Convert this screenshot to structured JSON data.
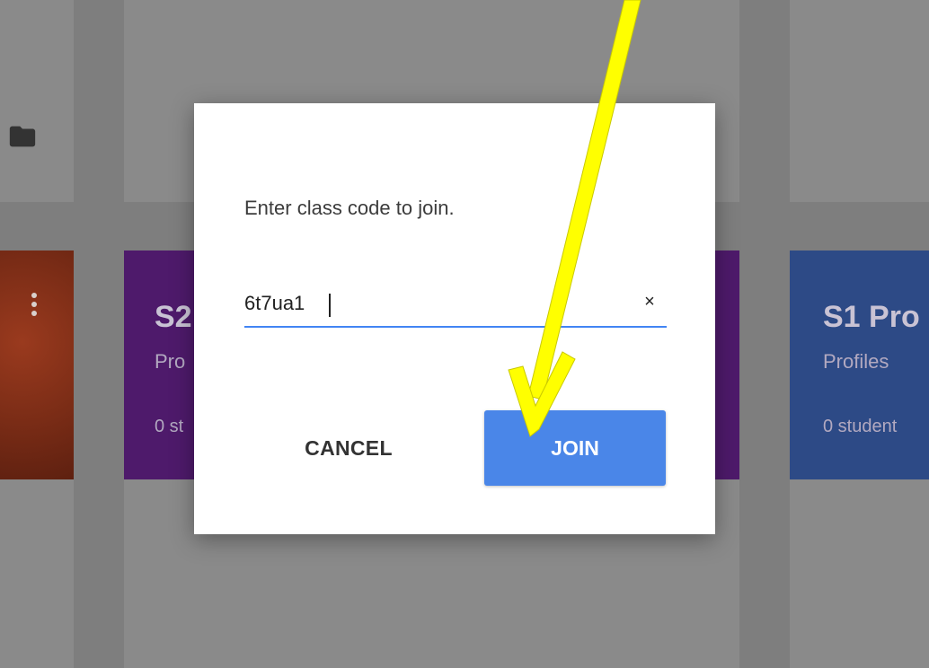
{
  "background": {
    "cards": [
      {
        "title": "",
        "subtitle": "",
        "count": ""
      },
      {
        "title": "S2",
        "subtitle": "Pro",
        "count": "0 st"
      },
      {
        "title": "",
        "subtitle": "",
        "count": ""
      },
      {
        "title": "S1 Pro",
        "subtitle": "Profiles",
        "count": "0 student"
      }
    ],
    "colors": {
      "overlay_gray": "#7e7e7e",
      "card_red": "#7a2c16",
      "card_purple": "#4e1a6b",
      "card_blue": "#2d4a86"
    }
  },
  "dialog": {
    "prompt": "Enter class code to join.",
    "code_value": "6t7ua1",
    "clear_icon": "×",
    "cancel_label": "CANCEL",
    "join_label": "JOIN",
    "accent_color": "#4a86e8"
  },
  "annotation": {
    "arrow_color": "#ffff00",
    "arrow_outline": "#c9c900"
  }
}
